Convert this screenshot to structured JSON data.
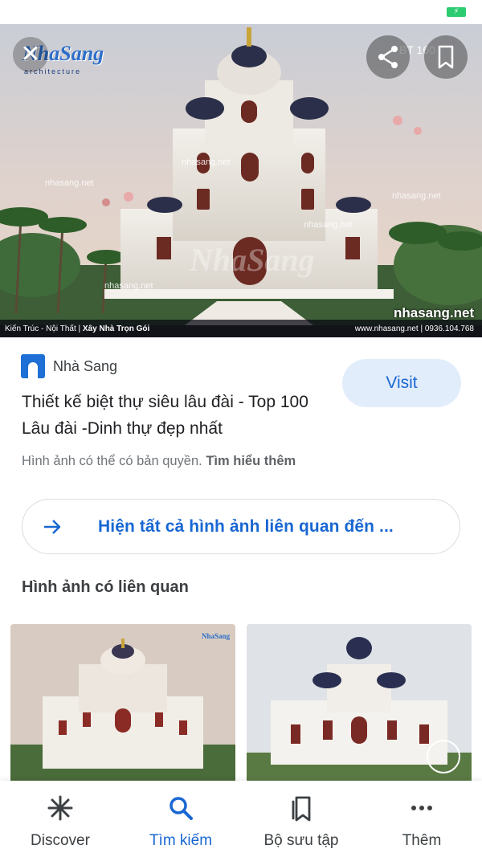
{
  "status_bar": {
    "battery_icon": "battery-charging-icon"
  },
  "hero": {
    "logo_text": "NhaSang",
    "logo_sub": "architecture",
    "close_icon": "close-icon",
    "share_icon": "share-icon",
    "bookmark_icon": "bookmark-icon",
    "code_text": "BT 160",
    "watermark": "nhasang.net",
    "site_big": "nhasang.net",
    "bottom_left": "Kiến Trúc - Nội Thất  |  ",
    "bottom_left_bold": "Xây Nhà Trọn Gói",
    "bottom_right": "www.nhasang.net | 0936.104.768"
  },
  "result": {
    "site_name": "Nhà Sang",
    "title": "Thiết kế biệt thự siêu lâu đài - Top 100 Lâu đài -Dinh thự đẹp nhất",
    "visit_label": "Visit",
    "copyright_text": "Hình ảnh có thể có bản quyền. ",
    "learn_more": "Tìm hiểu thêm"
  },
  "related_all": {
    "label": "Hiện tất cả hình ảnh liên quan đến ..."
  },
  "related": {
    "heading": "Hình ảnh có liên quan"
  },
  "bottom_nav": {
    "items": [
      {
        "label": "Discover",
        "icon": "asterisk-icon",
        "active": false
      },
      {
        "label": "Tìm kiếm",
        "icon": "search-icon",
        "active": true
      },
      {
        "label": "Bộ sưu tập",
        "icon": "collections-icon",
        "active": false
      },
      {
        "label": "Thêm",
        "icon": "more-icon",
        "active": false
      }
    ]
  },
  "colors": {
    "accent": "#1967d2",
    "visit_bg": "#e2edfb",
    "text_primary": "#202124",
    "text_secondary": "#70757a"
  }
}
